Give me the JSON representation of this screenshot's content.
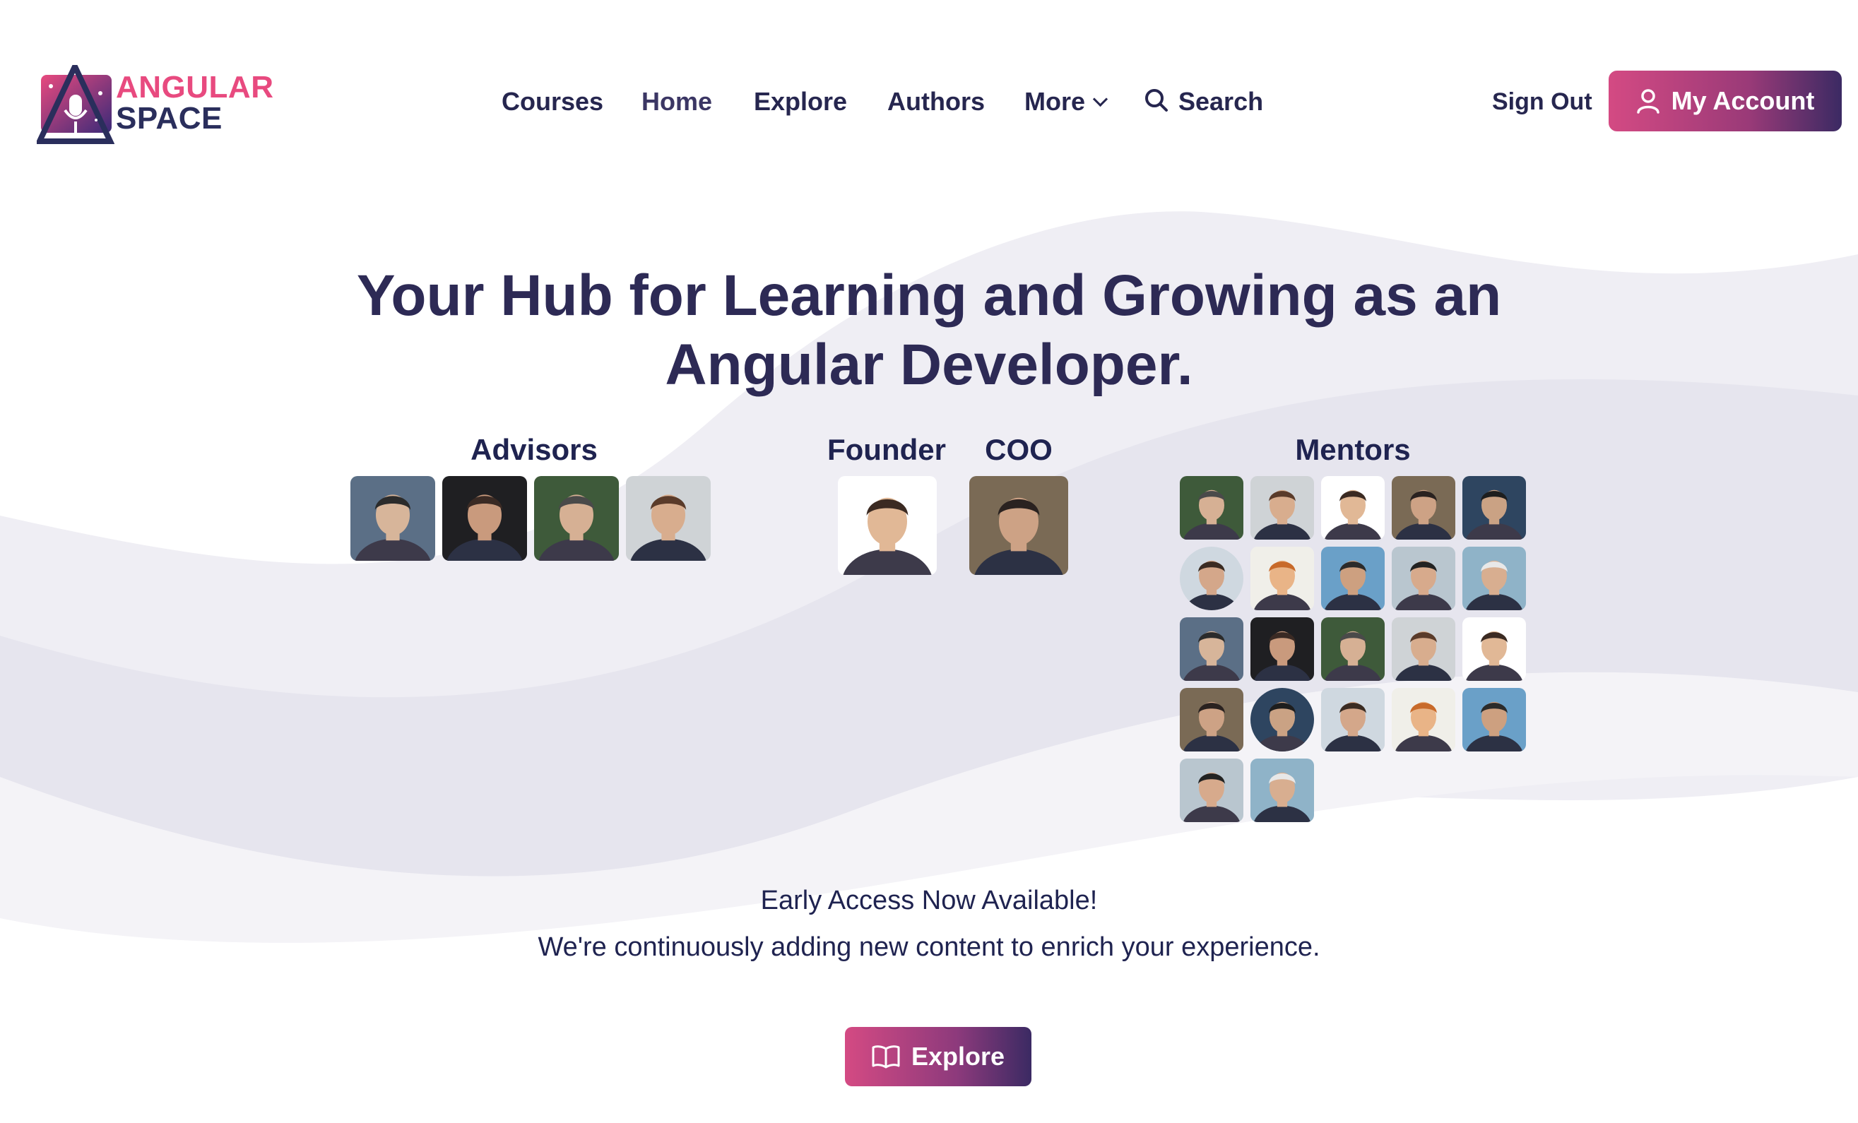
{
  "brand": {
    "line1": "ANGULAR",
    "line2": "SPACE"
  },
  "nav": {
    "items": [
      {
        "label": "Courses"
      },
      {
        "label": "Home"
      },
      {
        "label": "Explore"
      },
      {
        "label": "Authors"
      },
      {
        "label": "More"
      },
      {
        "label": "Search"
      }
    ],
    "sign_out": "Sign Out",
    "my_account": "My Account"
  },
  "hero": {
    "title_line1": "Your Hub for Learning and Growing as an",
    "title_line2": "Angular Developer."
  },
  "team": {
    "advisors_label": "Advisors",
    "founder_label": "Founder",
    "coo_label": "COO",
    "mentors_label": "Mentors",
    "advisor_count": 4,
    "mentor_count": 22
  },
  "notice": {
    "line1": "Early Access Now Available!",
    "line2": "We're continuously adding new content to enrich your experience."
  },
  "cta": {
    "explore_label": "Explore"
  },
  "colors": {
    "accent_pink": "#d44a83",
    "accent_purple": "#3b2a63",
    "text_dark": "#26264f"
  },
  "icons": [
    "logo-icon",
    "chevron-down-icon",
    "search-icon",
    "user-icon",
    "book-icon"
  ]
}
